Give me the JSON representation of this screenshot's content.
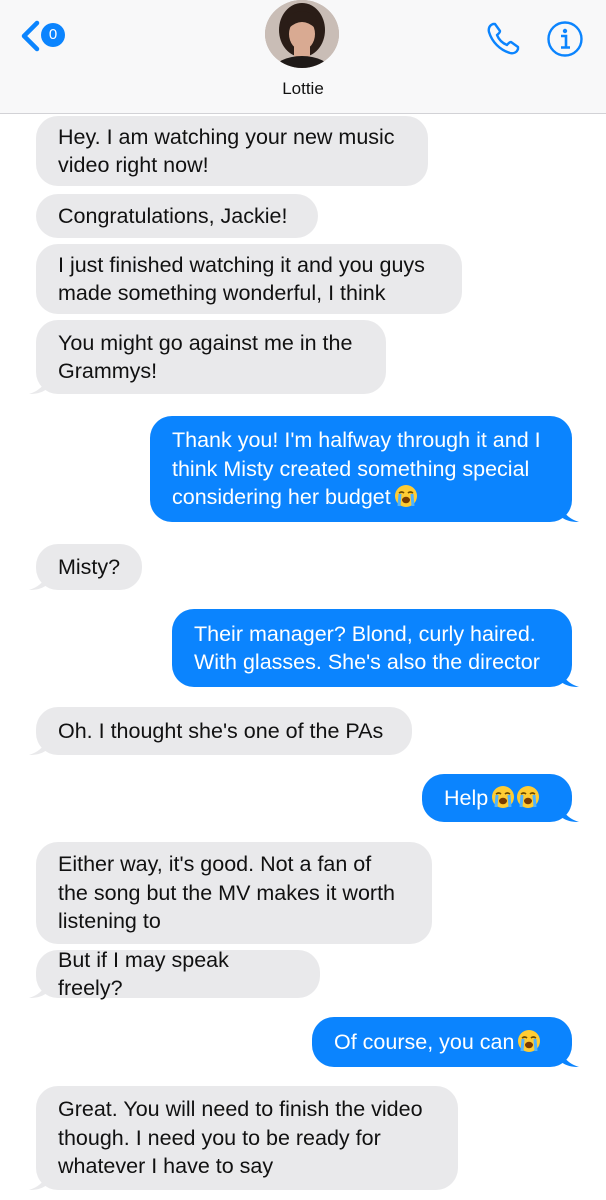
{
  "header": {
    "back_badge": "0",
    "contact_name": "Lottie",
    "back_icon": "chevron-left-icon",
    "call_icon": "phone-icon",
    "info_icon": "info-icon"
  },
  "colors": {
    "sent_bubble": "#0b84fe",
    "received_bubble": "#e9e9eb",
    "header_bg": "#f8f8f9"
  },
  "messages": [
    {
      "from": "contact",
      "text": "Hey. I am watching your new music\nvideo right now!"
    },
    {
      "from": "contact",
      "text": "Congratulations, Jackie!"
    },
    {
      "from": "contact",
      "text": "I just finished watching it and you guys\nmade something wonderful, I think"
    },
    {
      "from": "contact",
      "text": "You might go against me in the\nGrammys!"
    },
    {
      "from": "me",
      "text": "Thank you! I'm halfway through it and I\nthink Misty created something special\nconsidering her budget",
      "emoji": [
        "loudly-crying-face-emoji"
      ]
    },
    {
      "from": "contact",
      "text": "Misty?"
    },
    {
      "from": "me",
      "text": "Their manager? Blond, curly haired.\nWith glasses. She's also the director"
    },
    {
      "from": "contact",
      "text": "Oh. I thought she's one of the PAs"
    },
    {
      "from": "me",
      "text": "Help",
      "emoji": [
        "loudly-crying-face-emoji",
        "loudly-crying-face-emoji"
      ]
    },
    {
      "from": "contact",
      "text": "Either way, it's good. Not a fan of\nthe song but the MV makes it worth\nlistening to"
    },
    {
      "from": "contact",
      "text": "But if I may speak freely?"
    },
    {
      "from": "me",
      "text": "Of course, you can",
      "emoji": [
        "loudly-crying-face-emoji"
      ]
    },
    {
      "from": "contact",
      "text": "Great. You will need to finish the video\nthough. I need you to be ready for\nwhatever I have to say"
    }
  ]
}
